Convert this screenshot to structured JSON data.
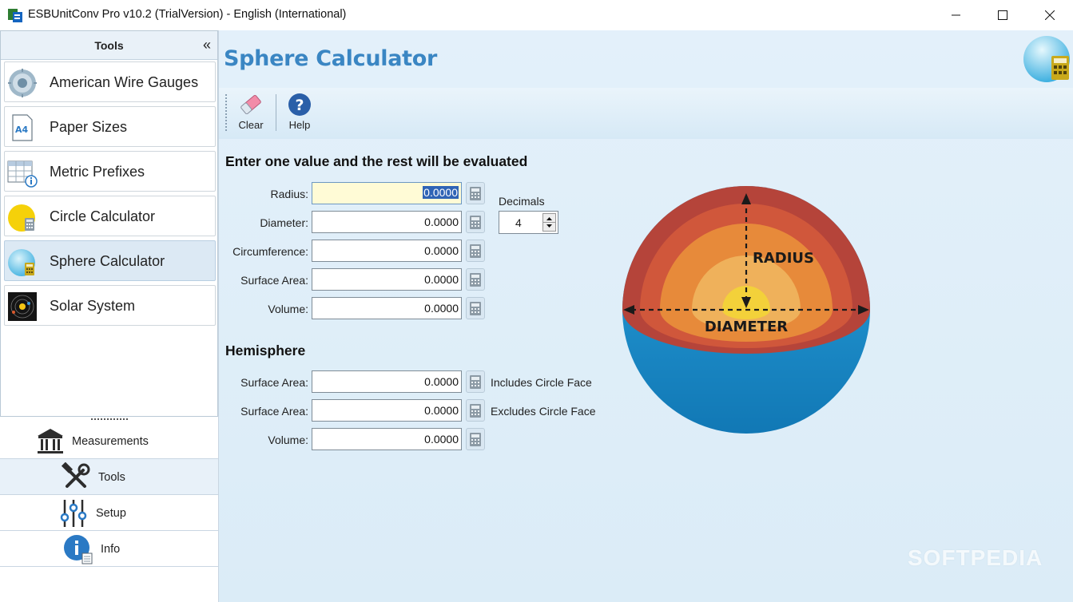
{
  "window": {
    "title": "ESBUnitConv Pro v10.2 (TrialVersion) - English (International)",
    "minimize": "—",
    "maximize": "☐",
    "close": "✕"
  },
  "sidebar": {
    "header": "Tools",
    "collapse": "«",
    "items": [
      {
        "label": "American Wire Gauges",
        "icon": "wire-gauge-icon"
      },
      {
        "label": "Paper Sizes",
        "icon": "a4-paper-icon"
      },
      {
        "label": "Metric Prefixes",
        "icon": "table-info-icon"
      },
      {
        "label": "Circle Calculator",
        "icon": "circle-calculator-icon"
      },
      {
        "label": "Sphere Calculator",
        "icon": "sphere-calculator-icon"
      },
      {
        "label": "Solar System",
        "icon": "solar-system-icon"
      }
    ],
    "selected": "Sphere Calculator",
    "nav": [
      {
        "label": "Measurements",
        "icon": "bank-building-icon"
      },
      {
        "label": "Tools",
        "icon": "wrench-hammer-icon"
      },
      {
        "label": "Setup",
        "icon": "sliders-icon"
      },
      {
        "label": "Info",
        "icon": "info-icon"
      }
    ]
  },
  "main": {
    "title": "Sphere Calculator",
    "toolbar": {
      "clear": "Clear",
      "help": "Help"
    },
    "instruction": "Enter one value and the rest will be evaluated",
    "fields": [
      {
        "label": "Radius:",
        "value": "0.0000"
      },
      {
        "label": "Diameter:",
        "value": "0.0000"
      },
      {
        "label": "Circumference:",
        "value": "0.0000"
      },
      {
        "label": "Surface Area:",
        "value": "0.0000"
      },
      {
        "label": "Volume:",
        "value": "0.0000"
      }
    ],
    "decimals": {
      "label": "Decimals",
      "value": "4"
    },
    "hemisphere": {
      "heading": "Hemisphere",
      "fields": [
        {
          "label": "Surface Area:",
          "value": "0.0000",
          "note": "Includes Circle Face"
        },
        {
          "label": "Surface Area:",
          "value": "0.0000",
          "note": "Excludes Circle Face"
        },
        {
          "label": "Volume:",
          "value": "0.0000",
          "note": ""
        }
      ]
    },
    "diagram": {
      "radius_label": "RADIUS",
      "diameter_label": "DIAMETER"
    },
    "watermark": "SOFTPEDIA"
  },
  "colors": {
    "title_blue": "#3a86c3",
    "sphere_blue": "#1f8fc9",
    "selection_blue": "#2f64b5",
    "active_field": "#fffbd6"
  }
}
